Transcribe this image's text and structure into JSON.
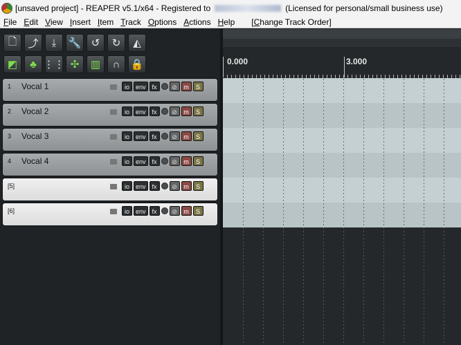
{
  "window": {
    "title_prefix": "[unsaved project] - REAPER v5.1/x64 - Registered to",
    "title_suffix": "(Licensed for personal/small business use)"
  },
  "menu": [
    "File",
    "Edit",
    "View",
    "Insert",
    "Item",
    "Track",
    "Options",
    "Actions",
    "Help",
    "[Change Track Order]"
  ],
  "toolbar": {
    "row1": [
      {
        "name": "new-project",
        "glyph": "🗋"
      },
      {
        "name": "open-project",
        "glyph": "⤴"
      },
      {
        "name": "save-project",
        "glyph": "⤓"
      },
      {
        "name": "project-settings",
        "glyph": "🔧"
      },
      {
        "name": "undo",
        "glyph": "↺"
      },
      {
        "name": "redo",
        "glyph": "↻"
      },
      {
        "name": "metronome",
        "glyph": "◭"
      }
    ],
    "row2": [
      {
        "name": "auto-crossfade",
        "glyph": "◩"
      },
      {
        "name": "item-grouping",
        "glyph": "♣"
      },
      {
        "name": "grid",
        "glyph": "⋮⋮"
      },
      {
        "name": "snap",
        "glyph": "✣"
      },
      {
        "name": "ripple-edit",
        "glyph": "▥"
      },
      {
        "name": "magnet",
        "glyph": "∩"
      },
      {
        "name": "lock",
        "glyph": "🔒"
      }
    ]
  },
  "tracks": [
    {
      "number": "1",
      "name": "Vocal 1",
      "style": "named"
    },
    {
      "number": "2",
      "name": "Vocal 2",
      "style": "named"
    },
    {
      "number": "3",
      "name": "Vocal 3",
      "style": "named"
    },
    {
      "number": "4",
      "name": "Vocal 4",
      "style": "named"
    },
    {
      "number": "[5]",
      "name": "",
      "style": "empty"
    },
    {
      "number": "[6]",
      "name": "",
      "style": "empty"
    }
  ],
  "track_buttons": {
    "io": "io",
    "env": "env",
    "fx": "fx",
    "phase": "⊘",
    "mute": "m",
    "solo": "S"
  },
  "ruler": {
    "start_label": "0.000",
    "mark_label": "3.000"
  }
}
